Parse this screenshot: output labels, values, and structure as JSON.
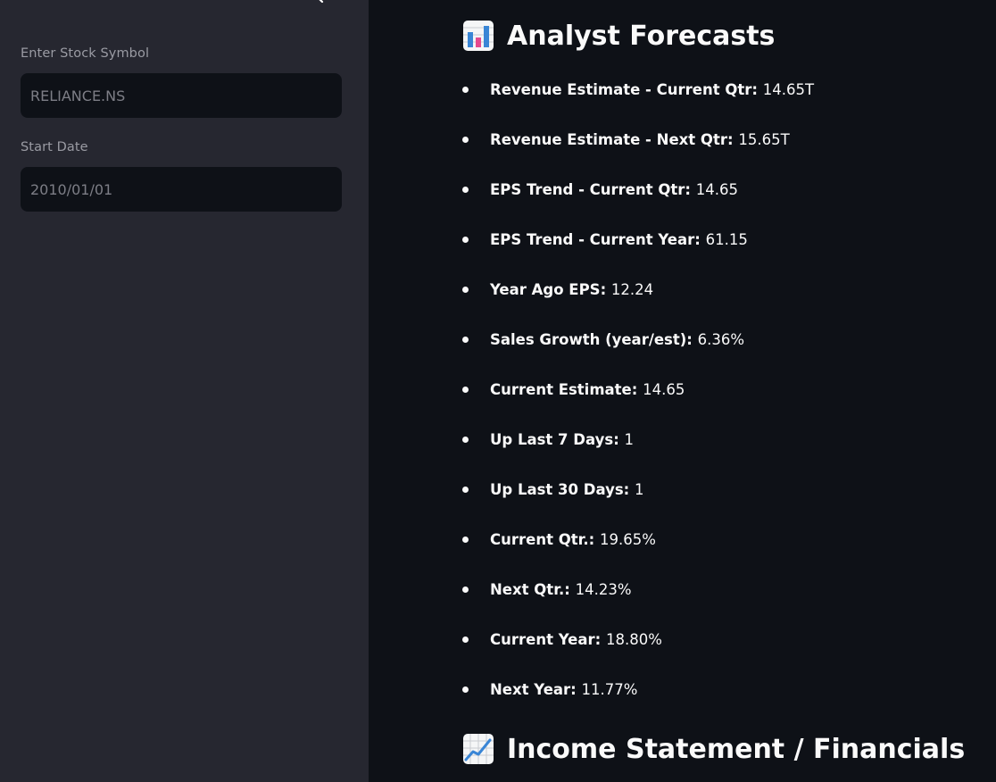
{
  "sidebar": {
    "collapse_icon": "chevron-left-icon",
    "fields": [
      {
        "label": "Enter Stock Symbol",
        "value": "RELIANCE.NS"
      },
      {
        "label": "Start Date",
        "value": "2010/01/01"
      }
    ]
  },
  "main": {
    "forecasts": {
      "icon": "bar-chart-icon",
      "title": "Analyst Forecasts",
      "items": [
        {
          "key": "Revenue Estimate - Current Qtr",
          "value": "14.65T"
        },
        {
          "key": "Revenue Estimate - Next Qtr",
          "value": "15.65T"
        },
        {
          "key": "EPS Trend - Current Qtr",
          "value": "14.65"
        },
        {
          "key": "EPS Trend - Current Year",
          "value": "61.15"
        },
        {
          "key": "Year Ago EPS",
          "value": "12.24"
        },
        {
          "key": "Sales Growth (year/est)",
          "value": "6.36%"
        },
        {
          "key": "Current Estimate",
          "value": "14.65"
        },
        {
          "key": "Up Last 7 Days",
          "value": "1"
        },
        {
          "key": "Up Last 30 Days",
          "value": "1"
        },
        {
          "key": "Current Qtr.",
          "value": "19.65%"
        },
        {
          "key": "Next Qtr.",
          "value": "14.23%"
        },
        {
          "key": "Current Year",
          "value": "18.80%"
        },
        {
          "key": "Next Year",
          "value": "11.77%"
        }
      ]
    },
    "financials": {
      "icon": "chart-increasing-icon",
      "title": "Income Statement / Financials"
    }
  },
  "colors": {
    "sidebar_bg": "#262730",
    "main_bg": "#0e1117",
    "input_bg": "#0e1117",
    "label": "#9a9ba3",
    "text": "#fafafa"
  }
}
